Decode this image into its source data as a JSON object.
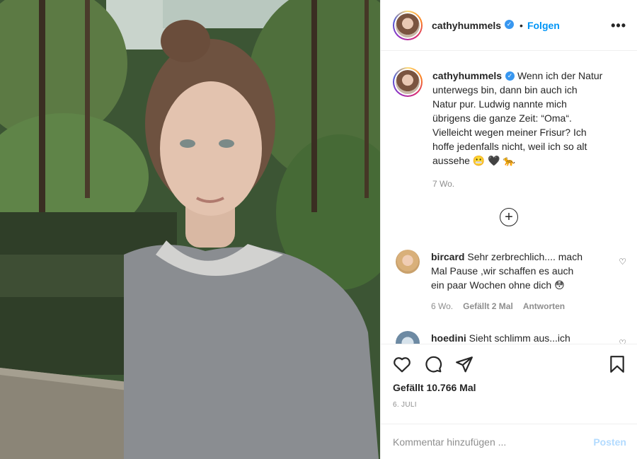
{
  "post": {
    "username": "cathyhummels",
    "follow_label": "Folgen",
    "dot": "•",
    "more": "•••"
  },
  "caption": {
    "username": "cathyhummels",
    "lines": [
      "Wenn ich der Natur",
      "unterwegs bin, dann bin auch ich",
      "Natur pur. Ludwig nannte mich",
      "übrigens die ganze Zeit: “Oma“.",
      "Vielleicht wegen meiner Frisur? Ich",
      "hoffe jedenfalls nicht, weil ich so alt",
      "aussehe"
    ],
    "time": "7 Wo."
  },
  "comments": [
    {
      "username": "bircard",
      "text_lines": [
        "Sehr zerbrechlich.... mach",
        "Mal Pause ,wir schaffen es auch",
        "ein paar Wochen ohne dich"
      ],
      "time": "6 Wo.",
      "likes": "Gefällt 2 Mal",
      "reply": "Antworten"
    },
    {
      "username": "hoedini",
      "text_lines": [
        "Sieht schlimm aus...ich"
      ]
    }
  ],
  "actions": {
    "likes": "Gefällt 10.766 Mal",
    "date": "6. JULI"
  },
  "add_comment": {
    "placeholder": "Kommentar hinzufügen ...",
    "post_label": "Posten"
  },
  "icons": [
    "verified-badge-icon",
    "more-icon",
    "plus-circle-icon",
    "heart-icon",
    "comment-icon",
    "share-icon",
    "bookmark-icon",
    "small-heart-icon"
  ]
}
